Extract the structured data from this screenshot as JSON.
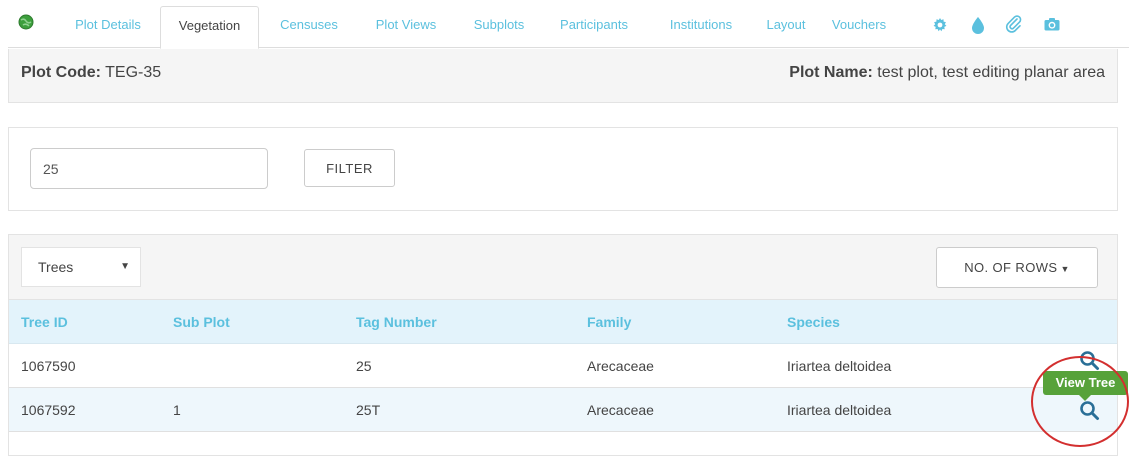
{
  "tabs": {
    "items": [
      {
        "label": "Plot Details"
      },
      {
        "label": "Vegetation"
      },
      {
        "label": "Censuses"
      },
      {
        "label": "Plot Views"
      },
      {
        "label": "Subplots"
      },
      {
        "label": "Participants"
      },
      {
        "label": "Institutions"
      },
      {
        "label": "Layout"
      },
      {
        "label": "Vouchers"
      }
    ],
    "active": "Vegetation",
    "icons": [
      "globe-icon",
      "gear-icon",
      "drop-icon",
      "paperclip-icon",
      "camera-icon"
    ]
  },
  "header": {
    "plot_code_label": "Plot Code:",
    "plot_code_value": "TEG-35",
    "plot_name_label": "Plot Name:",
    "plot_name_value": "test plot, test editing planar area"
  },
  "filter": {
    "input_value": "25",
    "button_label": "FILTER"
  },
  "table": {
    "type_select": "Trees",
    "rows_button": "NO. OF ROWS",
    "columns": [
      "Tree ID",
      "Sub Plot",
      "Tag Number",
      "Family",
      "Species"
    ],
    "rows": [
      {
        "tree_id": "1067590",
        "sub_plot": "",
        "tag_number": "25",
        "family": "Arecaceae",
        "species": "Iriartea deltoidea"
      },
      {
        "tree_id": "1067592",
        "sub_plot": "1",
        "tag_number": "25T",
        "family": "Arecaceae",
        "species": "Iriartea deltoidea"
      }
    ],
    "tooltip": "View Tree"
  },
  "colors": {
    "link": "#5bc0de",
    "tooltip": "#57a23a",
    "highlight": "#d32f2f",
    "globe": "#3c9f3c"
  }
}
